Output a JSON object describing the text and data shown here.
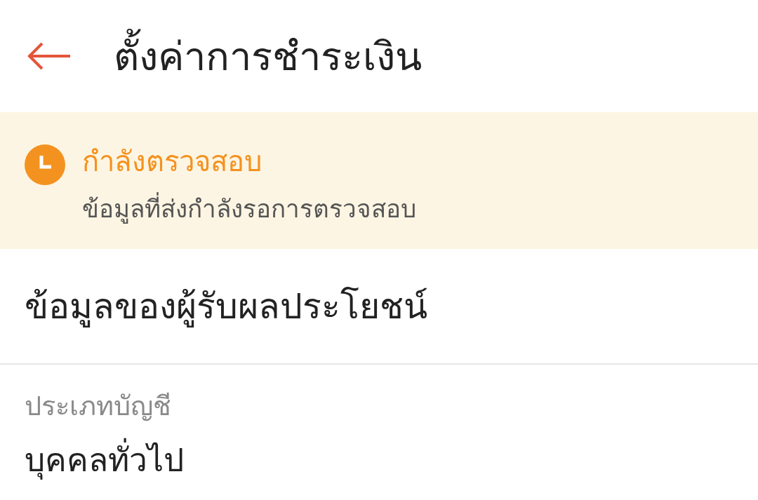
{
  "header": {
    "title": "ตั้งค่าการชำระเงิน"
  },
  "status": {
    "kind": "pending",
    "title": "กำลังตรวจสอบ",
    "message": "ข้อมูลที่ส่งกำลังรอการตรวจสอบ"
  },
  "section": {
    "title": "ข้อมูลของผู้รับผลประโยชน์"
  },
  "fields": [
    {
      "label": "ประเภทบัญชี",
      "value": "บุคคลทั่วไป"
    }
  ]
}
